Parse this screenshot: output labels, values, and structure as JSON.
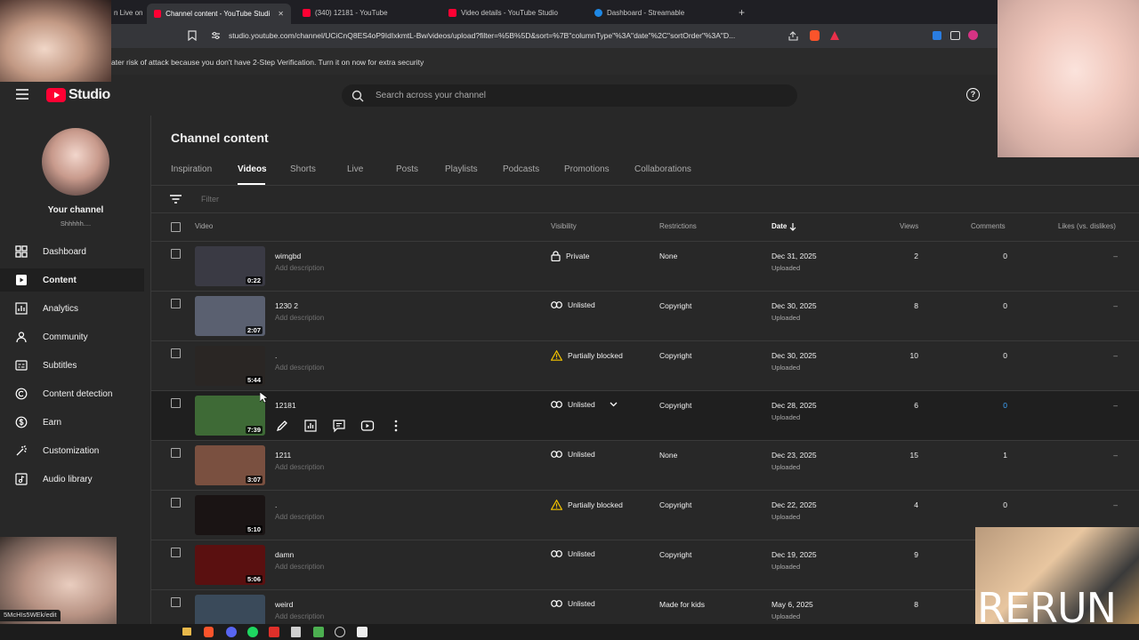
{
  "browser": {
    "tabs": [
      {
        "label": "n Live on"
      },
      {
        "label": "Channel content - YouTube Studi"
      },
      {
        "label": "(340) 12181 - YouTube"
      },
      {
        "label": "Video details - YouTube Studio"
      },
      {
        "label": "Dashboard - Streamable"
      }
    ],
    "new_tab": "+",
    "close_tab": "✕",
    "url": "studio.youtube.com/channel/UCiCnQ8ES4oP9IdIxkmtL-Bw/videos/upload?filter=%5B%5D&sort=%7B\"columnType\"%3A\"date\"%2C\"sortOrder\"%3A\"D..."
  },
  "banner": {
    "text": "ater risk of attack because you don't have 2-Step Verification. Turn it on now for extra security"
  },
  "studio": {
    "logo_text": "Studio",
    "search_placeholder": "Search across your channel",
    "help": "?"
  },
  "sidebar": {
    "channel_name": "Your channel",
    "channel_handle": "Shhhhh....",
    "items": [
      {
        "label": "Dashboard",
        "icon": "dashboard-icon"
      },
      {
        "label": "Content",
        "icon": "content-icon"
      },
      {
        "label": "Analytics",
        "icon": "analytics-icon"
      },
      {
        "label": "Community",
        "icon": "community-icon"
      },
      {
        "label": "Subtitles",
        "icon": "subtitles-icon"
      },
      {
        "label": "Content detection",
        "icon": "copyright-icon"
      },
      {
        "label": "Earn",
        "icon": "earn-icon"
      },
      {
        "label": "Customization",
        "icon": "customization-icon"
      },
      {
        "label": "Audio library",
        "icon": "audio-library-icon"
      }
    ],
    "status_url": "5McHIs5WEk/edit"
  },
  "main": {
    "title": "Channel content",
    "tabs": [
      "Inspiration",
      "Videos",
      "Shorts",
      "Live",
      "Posts",
      "Playlists",
      "Podcasts",
      "Promotions",
      "Collaborations"
    ],
    "filter_placeholder": "Filter",
    "columns": {
      "video": "Video",
      "visibility": "Visibility",
      "restrictions": "Restrictions",
      "date": "Date",
      "views": "Views",
      "comments": "Comments",
      "likes": "Likes (vs. dislikes)"
    },
    "rows": [
      {
        "title": "wimgbd",
        "desc": "Add description",
        "duration": "0:22",
        "visibility": "Private",
        "vis_icon": "lock-icon",
        "restrictions": "None",
        "date": "Dec 31, 2025",
        "date_sub": "Uploaded",
        "views": "2",
        "comments": "0",
        "likes": "–",
        "thumb_color": "#3a3a44"
      },
      {
        "title": "1230 2",
        "desc": "Add description",
        "duration": "2:07",
        "visibility": "Unlisted",
        "vis_icon": "link-icon",
        "restrictions": "Copyright",
        "date": "Dec 30, 2025",
        "date_sub": "Uploaded",
        "views": "8",
        "comments": "0",
        "likes": "–",
        "thumb_color": "#5a6070"
      },
      {
        "title": ".",
        "desc": "Add description",
        "duration": "5:44",
        "visibility": "Partially blocked",
        "vis_icon": "warning-icon",
        "restrictions": "Copyright",
        "date": "Dec 30, 2025",
        "date_sub": "Uploaded",
        "views": "10",
        "comments": "0",
        "likes": "–",
        "thumb_color": "#2a2624"
      },
      {
        "title": "12181",
        "desc": "",
        "duration": "7:39",
        "visibility": "Unlisted",
        "vis_icon": "link-icon",
        "restrictions": "Copyright",
        "date": "Dec 28, 2025",
        "date_sub": "Uploaded",
        "views": "6",
        "comments": "0",
        "likes": "–",
        "thumb_color": "#3e6a36"
      },
      {
        "title": "1211",
        "desc": "Add description",
        "duration": "3:07",
        "visibility": "Unlisted",
        "vis_icon": "link-icon",
        "restrictions": "None",
        "date": "Dec 23, 2025",
        "date_sub": "Uploaded",
        "views": "15",
        "comments": "1",
        "likes": "–",
        "thumb_color": "#7a5040"
      },
      {
        "title": ".",
        "desc": "Add description",
        "duration": "5:10",
        "visibility": "Partially blocked",
        "vis_icon": "warning-icon",
        "restrictions": "Copyright",
        "date": "Dec 22, 2025",
        "date_sub": "Uploaded",
        "views": "4",
        "comments": "0",
        "likes": "–",
        "thumb_color": "#1a1414"
      },
      {
        "title": "damn",
        "desc": "Add description",
        "duration": "5:06",
        "visibility": "Unlisted",
        "vis_icon": "link-icon",
        "restrictions": "Copyright",
        "date": "Dec 19, 2025",
        "date_sub": "Uploaded",
        "views": "9",
        "comments": "",
        "likes": "",
        "thumb_color": "#5a1010"
      },
      {
        "title": "weird",
        "desc": "Add description",
        "duration": "",
        "visibility": "Unlisted",
        "vis_icon": "link-icon",
        "restrictions": "Made for kids",
        "date": "May 6, 2025",
        "date_sub": "Uploaded",
        "views": "8",
        "comments": "",
        "likes": "",
        "thumb_color": "#3a4a5a"
      }
    ]
  },
  "overlays": {
    "rerun_text": "RERUN"
  },
  "colors": {
    "accent_red": "#ff0033",
    "warning": "#f2c200",
    "link_blue": "#3ea6ff"
  }
}
